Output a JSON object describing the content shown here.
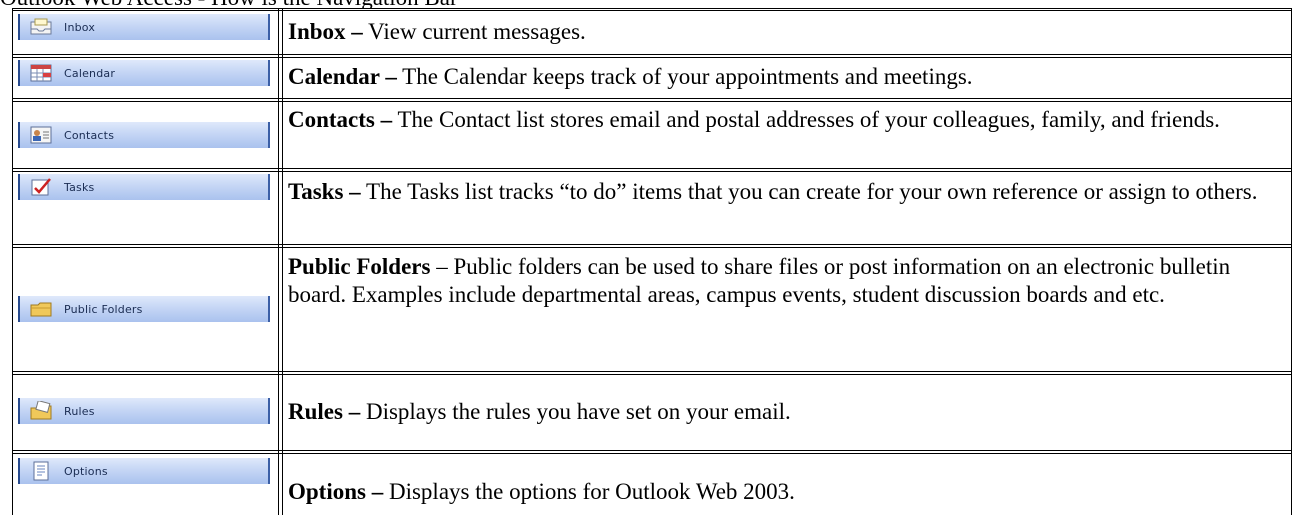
{
  "header": {
    "cut_text": "Outlook Web Access - How is the Navigation Bar"
  },
  "rows": [
    {
      "button_label": "Inbox",
      "icon": "inbox-icon",
      "term": "Inbox –",
      "description": " View current messages."
    },
    {
      "button_label": "Calendar",
      "icon": "calendar-icon",
      "term": "Calendar –",
      "description": " The Calendar keeps track of your appointments and meetings."
    },
    {
      "button_label": "Contacts",
      "icon": "contacts-icon",
      "term": "Contacts –",
      "description": " The Contact list stores email and postal addresses of your colleagues, family, and friends."
    },
    {
      "button_label": "Tasks",
      "icon": "tasks-icon",
      "term": "Tasks –",
      "description": " The Tasks list tracks “to do” items that you can create for your own reference or assign to others."
    },
    {
      "button_label": "Public Folders",
      "icon": "public-folders-icon",
      "term": "Public Folders",
      "description": " – Public folders can be used to share files or post information on an electronic bulletin board.  Examples include departmental areas, campus events, student discussion boards and etc."
    },
    {
      "button_label": "Rules",
      "icon": "rules-icon",
      "term": "Rules –",
      "description": " Displays the rules you have set on your email."
    },
    {
      "button_label": "Options",
      "icon": "options-icon",
      "term": "Options –",
      "description": " Displays the options for Outlook Web 2003."
    }
  ],
  "colors": {
    "button_top": "#dfe9fb",
    "button_bottom": "#aac2ee",
    "button_border": "#274a8e"
  }
}
